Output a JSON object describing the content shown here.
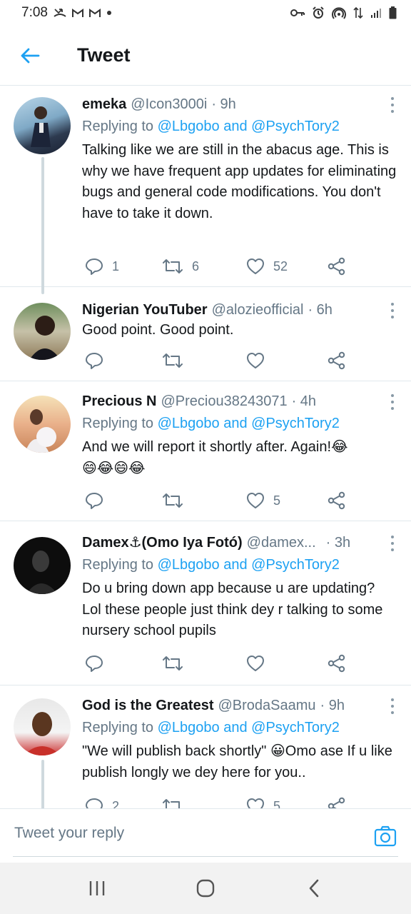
{
  "status_bar": {
    "time": "7:08",
    "left_icons": [
      "missed-call-icon",
      "gmail-icon",
      "gmail-icon",
      "dot-icon"
    ],
    "right_icons": [
      "key-icon",
      "alarm-icon",
      "hotspot-icon",
      "data-arrows-icon",
      "signal-icon",
      "battery-icon"
    ]
  },
  "header": {
    "title": "Tweet"
  },
  "tweets": [
    {
      "name": "emeka",
      "handle": "@Icon3000i",
      "time": "· 9h",
      "replying_prefix": "Replying to ",
      "replying_to": "@Lbgobo and @PsychTory2",
      "text": "Talking like we are still in the abacus age. This is why we have frequent app updates for eliminating bugs and general code modifications. You don't have to take it down.",
      "replies": "1",
      "retweets": "6",
      "likes": "52"
    },
    {
      "name": "Nigerian YouTuber",
      "handle": "@alozieofficial",
      "time": "· 6h",
      "text": "Good point. Good point.",
      "replies": "",
      "retweets": "",
      "likes": ""
    },
    {
      "name": "Precious N",
      "handle": "@Preciou38243071",
      "time": "· 4h",
      "replying_prefix": "Replying to ",
      "replying_to": "@Lbgobo and @PsychTory2",
      "text_main": "And we will report it shortly after. Again!",
      "emoji_line1": "😂",
      "emoji_line2": "😄😂😄😂",
      "replies": "",
      "retweets": "",
      "likes": "5"
    },
    {
      "name": "Damex⚓(Omo Iya Fotó)",
      "handle": "@damex...",
      "time": "· 3h",
      "replying_prefix": "Replying to ",
      "replying_to": "@Lbgobo and @PsychTory2",
      "text": "Do u bring down app because u are updating? Lol these people just think dey r talking to some nursery school pupils",
      "replies": "",
      "retweets": "",
      "likes": ""
    },
    {
      "name": "God is the Greatest",
      "handle": "@BrodaSaamu",
      "time": "· 9h",
      "replying_prefix": "Replying to ",
      "replying_to": "@Lbgobo and @PsychTory2",
      "text_a": "\"We will publish back shortly\" ",
      "emoji": "😀",
      "text_b": "Omo ase If u like publish longly we dey here for you..",
      "replies": "2",
      "retweets": "",
      "likes": "5"
    }
  ],
  "reply_bar": {
    "placeholder": "Tweet your reply"
  },
  "colors": {
    "accent": "#1da1f2",
    "muted": "#657786",
    "text": "#14171a",
    "divider": "#e1e8ed"
  }
}
